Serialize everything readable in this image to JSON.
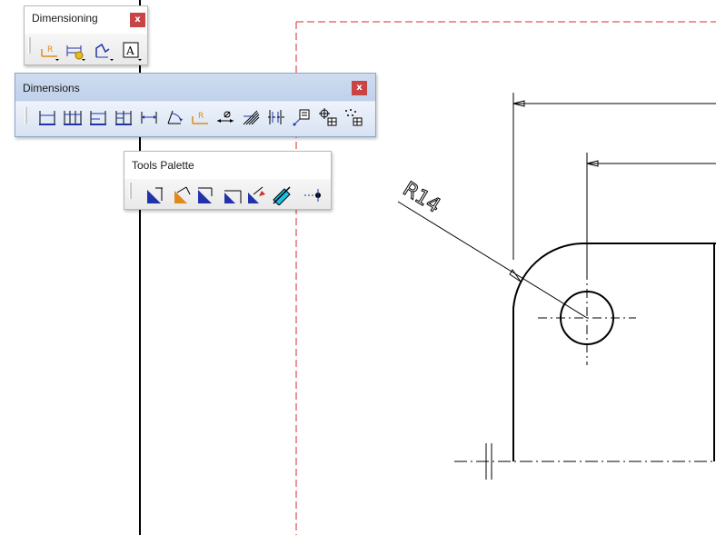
{
  "drawing": {
    "radius_label": "R14"
  },
  "toolbars": {
    "dimensioning": {
      "title": "Dimensioning",
      "close": "x",
      "buttons": [
        "radius-dimension-icon",
        "dimension-setup-icon",
        "datum-feature-icon",
        "text-icon"
      ]
    },
    "dimensions": {
      "title": "Dimensions",
      "close": "x",
      "buttons": [
        "dimension-icon",
        "chained-dimension-icon",
        "cumulated-dimension-icon",
        "stacked-dimension-icon",
        "length-distance-icon",
        "angle-dimension-icon",
        "radius-dimension-icon",
        "diameter-dimension-icon",
        "chamfer-dimension-icon",
        "thread-dimension-icon",
        "coordinate-dimension-icon",
        "hole-table-icon",
        "points-table-icon"
      ]
    },
    "tools": {
      "title": "Tools Palette",
      "buttons": [
        "projected-dimension-icon",
        "force-horizontal-icon",
        "force-vertical-icon",
        "force-along-direction-icon",
        "true-length-icon",
        "intersection-point-icon",
        "dimension-value-icon"
      ]
    }
  },
  "colors": {
    "frame_red": "#d42b2b",
    "blue_icon": "#2233aa",
    "orange_icon": "#e08a1e",
    "close_red": "#c94444"
  }
}
